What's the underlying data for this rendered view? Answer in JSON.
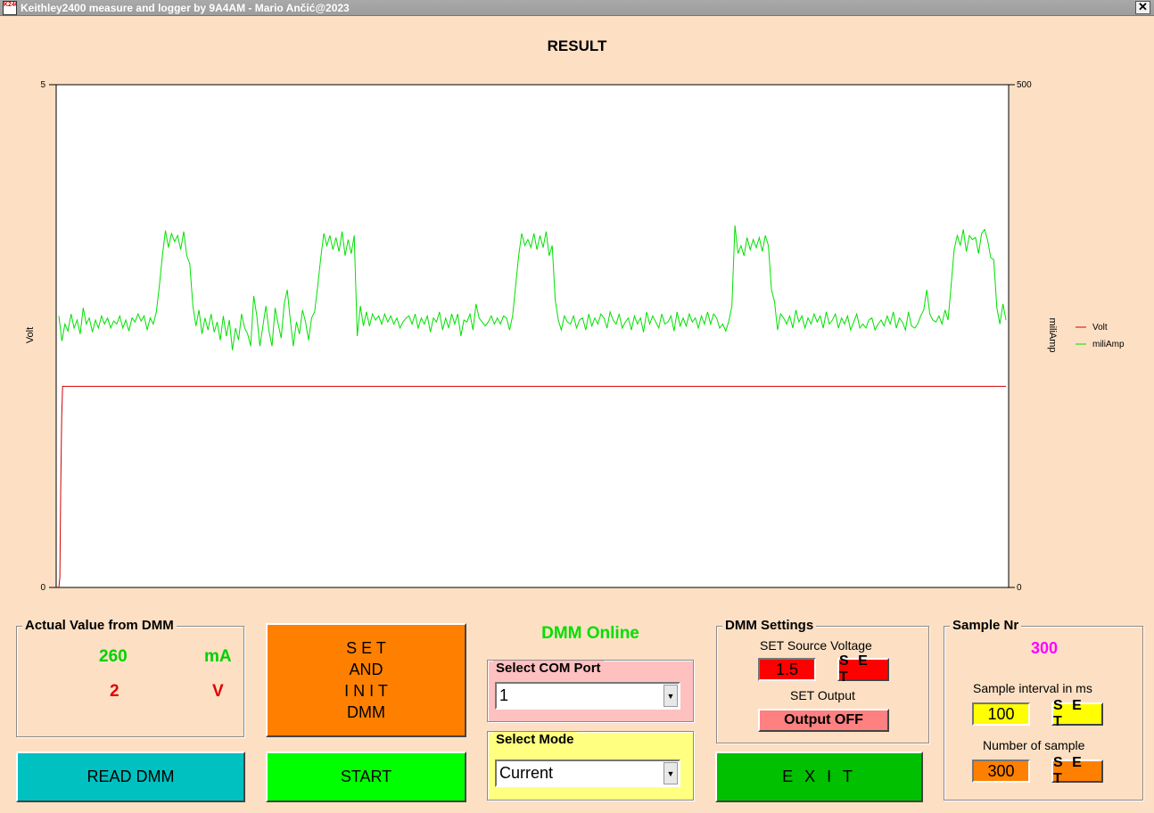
{
  "window": {
    "title": "Keithley2400 measure and logger by 9A4AM - Mario Ančić@2023",
    "icon_text": "K2400",
    "close_label": "✕"
  },
  "chart_data": {
    "type": "line",
    "title": "RESULT",
    "ylabel": "Volt",
    "y2label": "miliAmp",
    "ylim": [
      0,
      5
    ],
    "y2lim": [
      0,
      500
    ],
    "yticks": [
      "5",
      "0"
    ],
    "y2ticks": [
      "500",
      "0"
    ],
    "grid": false,
    "legend_position": "right",
    "legend": [
      {
        "name": "Volt",
        "color": "#d00000"
      },
      {
        "name": "miliAmp",
        "color": "#00e000"
      }
    ],
    "x": {
      "start": 0,
      "end": 300
    },
    "series": [
      {
        "name": "Volt",
        "axis": "left",
        "color": "#d00000",
        "values": [
          0.0,
          0.1,
          1.0,
          1.7,
          2.0,
          2.0
        ]
      },
      {
        "name": "miliAmp",
        "axis": "right",
        "color": "#00e000",
        "values": [
          270,
          245,
          262,
          255,
          272,
          258,
          266,
          252,
          278,
          262,
          268,
          254,
          266,
          258,
          270,
          262,
          268,
          258,
          265,
          262,
          270,
          258,
          266,
          255,
          268,
          264,
          272,
          265,
          270,
          256,
          268,
          262,
          274,
          300,
          330,
          355,
          338,
          352,
          344,
          350,
          336,
          354,
          330,
          322,
          280,
          260,
          276,
          252,
          268,
          256,
          272,
          254,
          264,
          246,
          270,
          250,
          266,
          236,
          258,
          246,
          272,
          258,
          252,
          240,
          290,
          270,
          240,
          260,
          280,
          255,
          240,
          278,
          262,
          248,
          282,
          296,
          266,
          240,
          264,
          252,
          276,
          264,
          246,
          268,
          274,
          300,
          328,
          352,
          340,
          350,
          336,
          348,
          334,
          354,
          330,
          346,
          332,
          350,
          250,
          280,
          260,
          274,
          260,
          272,
          266,
          270,
          262,
          272,
          264,
          270,
          262,
          268,
          258,
          264,
          268,
          270,
          262,
          272,
          258,
          268,
          262,
          270,
          254,
          268,
          264,
          274,
          256,
          268,
          258,
          272,
          262,
          272,
          250,
          266,
          264,
          272,
          256,
          282,
          268,
          264,
          260,
          264,
          270,
          262,
          268,
          262,
          270,
          268,
          256,
          270,
          300,
          330,
          352,
          340,
          346,
          338,
          352,
          336,
          350,
          338,
          354,
          330,
          340,
          286,
          266,
          256,
          270,
          264,
          262,
          270,
          258,
          266,
          268,
          256,
          272,
          260,
          268,
          262,
          272,
          268,
          258,
          274,
          266,
          262,
          272,
          258,
          264,
          268,
          256,
          270,
          262,
          268,
          254,
          274,
          262,
          270,
          264,
          258,
          272,
          262,
          264,
          270,
          255,
          274,
          260,
          268,
          260,
          272,
          264,
          268,
          258,
          270,
          262,
          274,
          262,
          272,
          268,
          258,
          262,
          255,
          265,
          280,
          360,
          332,
          340,
          330,
          348,
          336,
          346,
          338,
          348,
          334,
          350,
          340,
          296,
          284,
          256,
          272,
          268,
          262,
          270,
          258,
          276,
          264,
          270,
          258,
          268,
          262,
          272,
          264,
          270,
          258,
          274,
          262,
          266,
          272,
          258,
          268,
          262,
          270,
          256,
          264,
          272,
          258,
          262,
          258,
          266,
          268,
          256,
          262,
          266,
          260,
          270,
          262,
          274,
          258,
          268,
          264,
          256,
          274,
          260,
          258,
          262,
          270,
          276,
          296,
          272,
          266,
          264,
          270,
          262,
          276,
          266,
          300,
          336,
          350,
          340,
          356,
          334,
          350,
          346,
          348,
          332,
          352,
          356,
          345,
          328,
          326,
          278,
          262,
          282,
          266
        ]
      }
    ]
  },
  "actual": {
    "legend": "Actual Value from DMM",
    "current_value": "260",
    "current_unit": "mA",
    "voltage_value": "2",
    "voltage_unit": "V"
  },
  "buttons": {
    "read_dmm": "READ DMM",
    "set_init": [
      "S E T",
      "AND",
      "I N I T",
      "DMM"
    ],
    "start": "START",
    "exit": "E X I T"
  },
  "status": {
    "text": "DMM Online"
  },
  "com": {
    "legend": "Select COM Port",
    "value": "1"
  },
  "mode": {
    "legend": "Select Mode",
    "value": "Current"
  },
  "dmm_settings": {
    "legend": "DMM Settings",
    "source_voltage_label": "SET Source Voltage",
    "source_voltage_value": "1.5",
    "set_label": "S E T",
    "output_label": "SET Output",
    "output_button": "Output OFF"
  },
  "sample": {
    "legend": "Sample Nr",
    "count_value": "300",
    "interval_label": "Sample interval in ms",
    "interval_value": "100",
    "interval_set": "S E T",
    "number_label": "Number of sample",
    "number_value": "300",
    "number_set": "S E T"
  },
  "colors": {
    "background": "#fde0c4",
    "read_btn": "#00c0c0",
    "init_btn": "#ff8000",
    "start_btn": "#00ff00",
    "exit_btn": "#00c000",
    "online": "#00e000",
    "current": "#00d000",
    "voltage": "#e00000",
    "sample_nr": "#ff00ff"
  }
}
